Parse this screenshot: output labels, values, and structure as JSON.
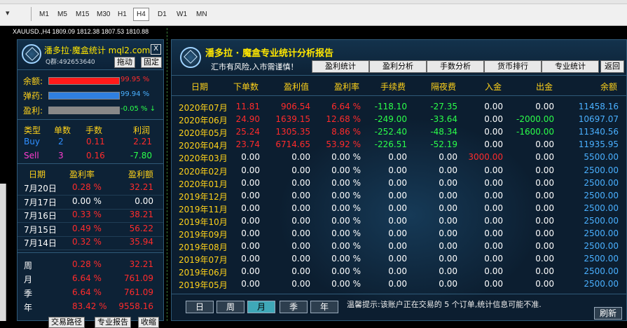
{
  "toolbar": {
    "drop_arrow": "▾",
    "timeframes": [
      "M1",
      "M5",
      "M15",
      "M30",
      "H1",
      "H4",
      "D1",
      "W1",
      "MN"
    ],
    "active_timeframe": "H4"
  },
  "chart": {
    "info": "XAUUSD.,H4  1809.09 1812.38 1807.53 1810.88"
  },
  "left_panel": {
    "title": "潘多拉·魔盒统计 mql2.com",
    "qq": "Q群:492653640",
    "close": "X",
    "drag_btn": "拖动",
    "fix_btn": "固定",
    "meters": [
      {
        "label": "余额:",
        "value": "99.95 %",
        "color": "#ff1a1a",
        "fill": 0.9995
      },
      {
        "label": "弹药:",
        "value": "99.94 %",
        "color": "#2f7fe0",
        "fill": 0.9994
      },
      {
        "label": "盈利:",
        "value": "-0.05 % ↓",
        "color": "#888888",
        "fill": 1.0
      }
    ],
    "type_headers": [
      "类型",
      "单数",
      "手数",
      "利润"
    ],
    "type_rows": [
      {
        "type": "Buy",
        "count": "2",
        "lots": "0.11",
        "profit": "2.21"
      },
      {
        "type": "Sell",
        "count": "3",
        "lots": "0.16",
        "profit": "-7.80"
      }
    ],
    "day_headers": [
      "日期",
      "盈利率",
      "盈利额"
    ],
    "day_rows": [
      {
        "date": "7月20日",
        "rate": "0.28 %",
        "amount": "32.21"
      },
      {
        "date": "7月17日",
        "rate": "0.00 %",
        "amount": "0.00"
      },
      {
        "date": "7月16日",
        "rate": "0.33 %",
        "amount": "38.21"
      },
      {
        "date": "7月15日",
        "rate": "0.49 %",
        "amount": "56.22"
      },
      {
        "date": "7月14日",
        "rate": "0.32 %",
        "amount": "35.94"
      }
    ],
    "period_rows": [
      {
        "label": "周",
        "rate": "0.28 %",
        "amount": "32.21"
      },
      {
        "label": "月",
        "rate": "6.64 %",
        "amount": "761.09"
      },
      {
        "label": "季",
        "rate": "6.64 %",
        "amount": "761.09"
      },
      {
        "label": "年",
        "rate": "83.42 %",
        "amount": "9558.16"
      }
    ],
    "bottom_buttons": [
      "交易路径",
      "专业报告",
      "收缩"
    ]
  },
  "main_panel": {
    "title": "潘多拉 · 魔盒专业统计分析报告",
    "subtitle": "汇市有风险,入市需谨慎！",
    "tabs": [
      "盈利统计",
      "盈利分析",
      "手数分析",
      "货币排行",
      "专业统计",
      "返回"
    ],
    "columns": [
      "日期",
      "下单数",
      "盈利值",
      "盈利率",
      "手续费",
      "隔夜费",
      "入金",
      "出金",
      "余额"
    ],
    "rows": [
      {
        "date": "2020年07月",
        "orders": "11.81",
        "profit": "906.54",
        "rate": "6.64 %",
        "fee": "-118.10",
        "swap": "-27.35",
        "deposit": "0.00",
        "withdraw": "0.00",
        "balance": "11458.16"
      },
      {
        "date": "2020年06月",
        "orders": "24.90",
        "profit": "1639.15",
        "rate": "12.68 %",
        "fee": "-249.00",
        "swap": "-33.64",
        "deposit": "0.00",
        "withdraw": "-2000.00",
        "balance": "10697.07"
      },
      {
        "date": "2020年05月",
        "orders": "25.24",
        "profit": "1305.35",
        "rate": "8.86 %",
        "fee": "-252.40",
        "swap": "-48.34",
        "deposit": "0.00",
        "withdraw": "-1600.00",
        "balance": "11340.56"
      },
      {
        "date": "2020年04月",
        "orders": "23.74",
        "profit": "6714.65",
        "rate": "53.92 %",
        "fee": "-226.51",
        "swap": "-52.19",
        "deposit": "0.00",
        "withdraw": "0.00",
        "balance": "11935.95"
      },
      {
        "date": "2020年03月",
        "orders": "0.00",
        "profit": "0.00",
        "rate": "0.00 %",
        "fee": "0.00",
        "swap": "0.00",
        "deposit": "3000.00",
        "withdraw": "0.00",
        "balance": "5500.00"
      },
      {
        "date": "2020年02月",
        "orders": "0.00",
        "profit": "0.00",
        "rate": "0.00 %",
        "fee": "0.00",
        "swap": "0.00",
        "deposit": "0.00",
        "withdraw": "0.00",
        "balance": "2500.00"
      },
      {
        "date": "2020年01月",
        "orders": "0.00",
        "profit": "0.00",
        "rate": "0.00 %",
        "fee": "0.00",
        "swap": "0.00",
        "deposit": "0.00",
        "withdraw": "0.00",
        "balance": "2500.00"
      },
      {
        "date": "2019年12月",
        "orders": "0.00",
        "profit": "0.00",
        "rate": "0.00 %",
        "fee": "0.00",
        "swap": "0.00",
        "deposit": "0.00",
        "withdraw": "0.00",
        "balance": "2500.00"
      },
      {
        "date": "2019年11月",
        "orders": "0.00",
        "profit": "0.00",
        "rate": "0.00 %",
        "fee": "0.00",
        "swap": "0.00",
        "deposit": "0.00",
        "withdraw": "0.00",
        "balance": "2500.00"
      },
      {
        "date": "2019年10月",
        "orders": "0.00",
        "profit": "0.00",
        "rate": "0.00 %",
        "fee": "0.00",
        "swap": "0.00",
        "deposit": "0.00",
        "withdraw": "0.00",
        "balance": "2500.00"
      },
      {
        "date": "2019年09月",
        "orders": "0.00",
        "profit": "0.00",
        "rate": "0.00 %",
        "fee": "0.00",
        "swap": "0.00",
        "deposit": "0.00",
        "withdraw": "0.00",
        "balance": "2500.00"
      },
      {
        "date": "2019年08月",
        "orders": "0.00",
        "profit": "0.00",
        "rate": "0.00 %",
        "fee": "0.00",
        "swap": "0.00",
        "deposit": "0.00",
        "withdraw": "0.00",
        "balance": "2500.00"
      },
      {
        "date": "2019年07月",
        "orders": "0.00",
        "profit": "0.00",
        "rate": "0.00 %",
        "fee": "0.00",
        "swap": "0.00",
        "deposit": "0.00",
        "withdraw": "0.00",
        "balance": "2500.00"
      },
      {
        "date": "2019年06月",
        "orders": "0.00",
        "profit": "0.00",
        "rate": "0.00 %",
        "fee": "0.00",
        "swap": "0.00",
        "deposit": "0.00",
        "withdraw": "0.00",
        "balance": "2500.00"
      },
      {
        "date": "2019年05月",
        "orders": "0.00",
        "profit": "0.00",
        "rate": "0.00 %",
        "fee": "0.00",
        "swap": "0.00",
        "deposit": "0.00",
        "withdraw": "0.00",
        "balance": "2500.00"
      }
    ],
    "periods": [
      "日",
      "周",
      "月",
      "季",
      "年"
    ],
    "active_period": "月",
    "note": "温馨提示:该账户正在交易的 5 个订单,统计信息可能不准.",
    "refresh": "刷新"
  },
  "colors": {
    "positive": "#2bff4a",
    "negative": "#ff2b2b",
    "header": "#ffd21a",
    "balance": "#4ab0ff",
    "panel_bg": "#0d2236"
  }
}
